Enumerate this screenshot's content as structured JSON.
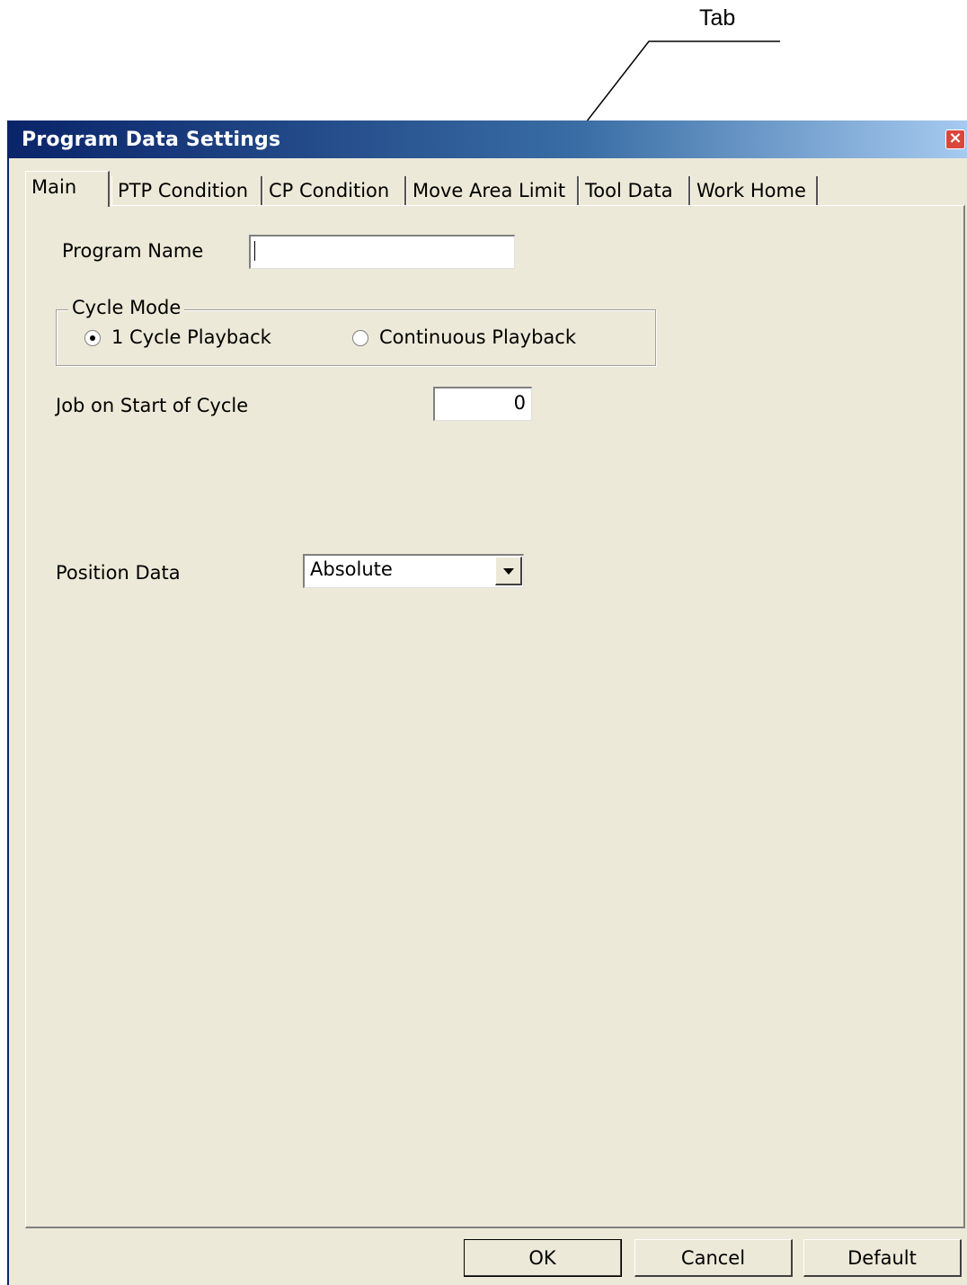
{
  "callout": {
    "label": "Tab"
  },
  "window": {
    "title": "Program Data Settings",
    "close_symbol": "×"
  },
  "tabs": [
    {
      "label": "Main",
      "active": true
    },
    {
      "label": "PTP Condition",
      "active": false
    },
    {
      "label": "CP Condition",
      "active": false
    },
    {
      "label": "Move Area Limit",
      "active": false
    },
    {
      "label": "Tool Data",
      "active": false
    },
    {
      "label": "Work Home",
      "active": false
    }
  ],
  "main": {
    "program_name_label": "Program Name",
    "program_name_value": "",
    "cycle_mode": {
      "legend": "Cycle Mode",
      "options": [
        {
          "label": "1 Cycle Playback",
          "selected": true
        },
        {
          "label": "Continuous Playback",
          "selected": false
        }
      ]
    },
    "job_on_start_label": "Job on Start of Cycle",
    "job_on_start_value": "0",
    "position_data_label": "Position Data",
    "position_data_value": "Absolute"
  },
  "buttons": {
    "ok": "OK",
    "cancel": "Cancel",
    "default": "Default"
  },
  "colors": {
    "titlebar_start": "#0a246a",
    "titlebar_end": "#a6caf0",
    "dialog_bg": "#ece9d8"
  }
}
